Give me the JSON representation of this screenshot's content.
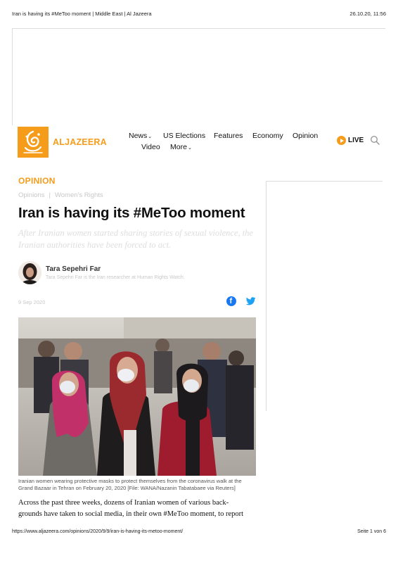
{
  "print_header": {
    "title": "Iran is having its #MeToo moment | Middle East | Al Jazeera",
    "date": "26.10.20, 11:56"
  },
  "site": {
    "logo_text": "ALJAZEERA",
    "brand_color": "#f59c1a",
    "nav": {
      "news": "News",
      "us_elections": "US Elections",
      "features": "Features",
      "economy": "Economy",
      "opinion": "Opinion",
      "video": "Video",
      "more": "More"
    },
    "live_label": "LIVE",
    "search_icon": "search-icon"
  },
  "article": {
    "section": "OPINION",
    "breadcrumbs": [
      "Opinions",
      "Women's Rights"
    ],
    "headline": "Iran is having its #MeToo moment",
    "standfirst": "After Iranian women started sharing stories of sexual violence, the Iranian authorities have been forced to act.",
    "author": {
      "name": "Tara Sepehri Far",
      "bio": "Tara Sepehri Far is the Iran researcher at Human Rights Watch."
    },
    "date": "9 Sep 2020",
    "share_icons": [
      "facebook-icon",
      "twitter-icon"
    ],
    "image_caption": "Iranian women wearing protective masks to protect themselves from the coronavirus walk at the Grand Bazaar in Tehran on February 20, 2020 [File: WANA/Nazanin Tabatabaee via Reuters]",
    "body_lines": [
      "Across the past three weeks, dozens of Iranian women of various back-",
      "grounds have taken to social media, in their own #MeToo moment, to report"
    ]
  },
  "print_footer": {
    "url": "https://www.aljazeera.com/opinions/2020/9/9/iran-is-having-its-metoo-moment/",
    "page": "Seite 1 von 6"
  }
}
